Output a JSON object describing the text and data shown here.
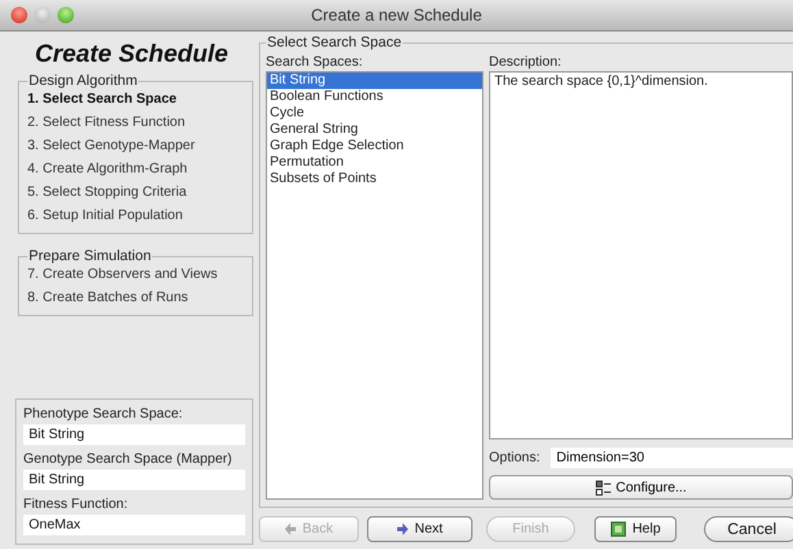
{
  "window": {
    "title": "Create a new Schedule"
  },
  "heading": "Create Schedule",
  "step_groups": [
    {
      "title": "Design Algorithm",
      "steps": [
        {
          "label": "1. Select Search Space",
          "selected": true
        },
        {
          "label": "2. Select Fitness Function",
          "selected": false
        },
        {
          "label": "3. Select Genotype-Mapper",
          "selected": false
        },
        {
          "label": "4. Create Algorithm-Graph",
          "selected": false
        },
        {
          "label": "5. Select Stopping Criteria",
          "selected": false
        },
        {
          "label": "6. Setup Initial Population",
          "selected": false
        }
      ]
    },
    {
      "title": "Prepare Simulation",
      "steps": [
        {
          "label": "7. Create Observers and Views",
          "selected": false
        },
        {
          "label": "8. Create Batches of Runs",
          "selected": false
        }
      ]
    }
  ],
  "summary": [
    {
      "label": "Phenotype Search Space:",
      "value": "Bit String"
    },
    {
      "label": "Genotype Search Space (Mapper)",
      "value": "Bit String"
    },
    {
      "label": "Fitness Function:",
      "value": "OneMax"
    }
  ],
  "panel": {
    "title": "Select Search Space",
    "list_label": "Search Spaces:",
    "items": [
      {
        "label": "Bit String",
        "selected": true
      },
      {
        "label": "Boolean Functions",
        "selected": false
      },
      {
        "label": "Cycle",
        "selected": false
      },
      {
        "label": "General String",
        "selected": false
      },
      {
        "label": "Graph Edge Selection",
        "selected": false
      },
      {
        "label": "Permutation",
        "selected": false
      },
      {
        "label": "Subsets of Points",
        "selected": false
      }
    ],
    "description_label": "Description:",
    "description": "The search space {0,1}^dimension.",
    "options_label": "Options:",
    "options_value": "Dimension=30",
    "configure": "Configure..."
  },
  "buttons": [
    {
      "kind": "back",
      "label": "Back",
      "disabled": true
    },
    {
      "kind": "next",
      "label": "Next",
      "disabled": false
    },
    {
      "kind": "finish",
      "label": "Finish",
      "disabled": true
    },
    {
      "kind": "help",
      "label": "Help",
      "disabled": false
    },
    {
      "kind": "cancel",
      "label": "Cancel",
      "disabled": false
    }
  ]
}
